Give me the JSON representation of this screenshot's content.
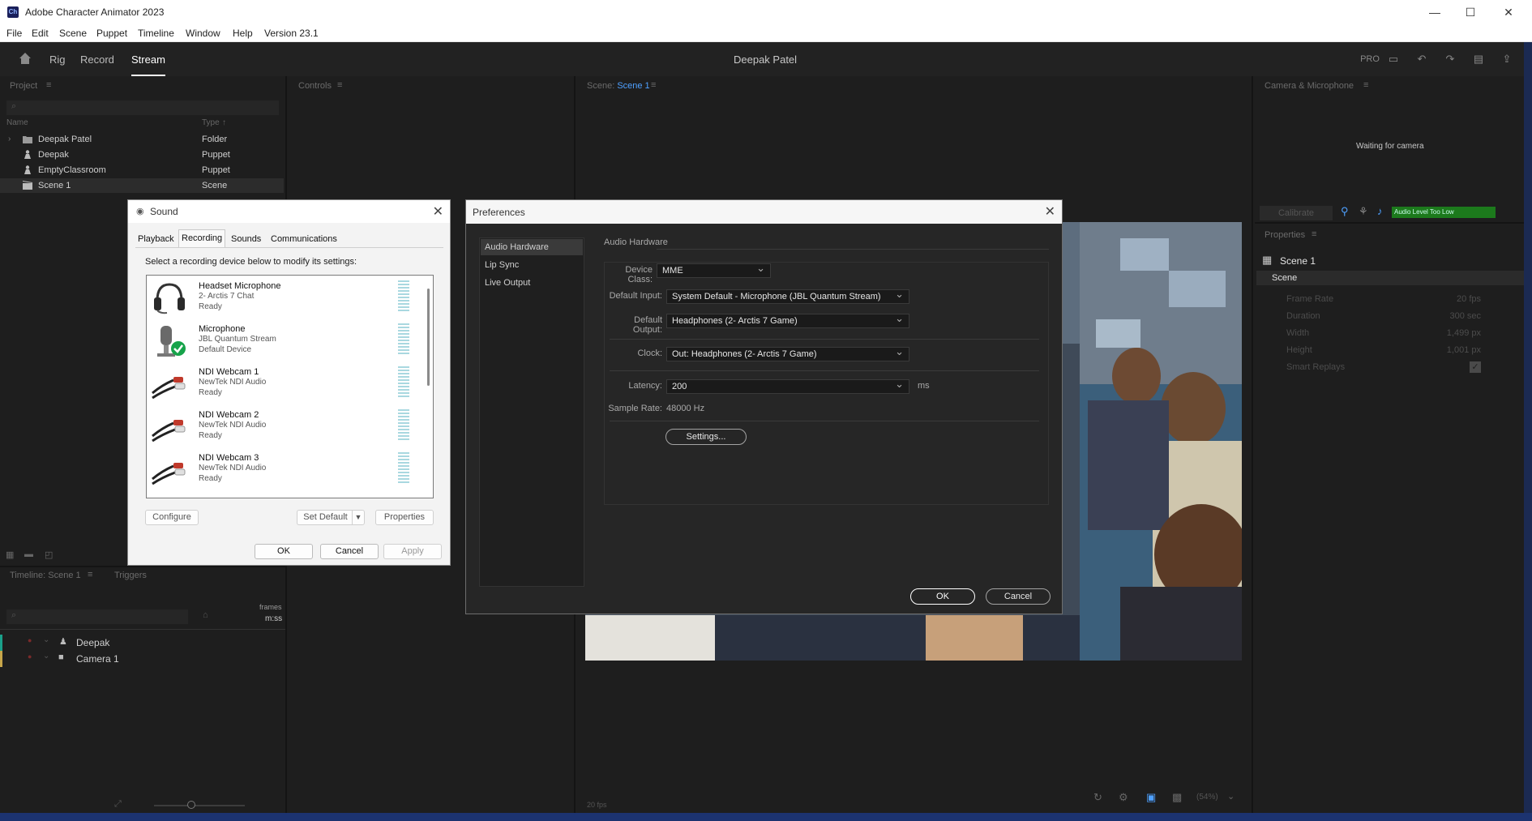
{
  "window": {
    "app_title": "Adobe Character Animator 2023",
    "logo_text": "Ch",
    "minimize": "—",
    "maximize": "☐",
    "close": "✕"
  },
  "menu": [
    "File",
    "Edit",
    "Scene",
    "Puppet",
    "Timeline",
    "Window",
    "Help",
    "Version 23.1"
  ],
  "appbar": {
    "workspaces": [
      "Rig",
      "Record",
      "Stream"
    ],
    "active_workspace": "Stream",
    "center_title": "Deepak Patel",
    "pro_label": "PRO"
  },
  "project": {
    "header": "Project",
    "col_name": "Name",
    "col_type": "Type",
    "items": [
      {
        "name": "Deepak Patel",
        "type": "Folder",
        "icon": "folder-icon"
      },
      {
        "name": "Deepak",
        "type": "Puppet",
        "icon": "puppet-icon"
      },
      {
        "name": "EmptyClassroom",
        "type": "Puppet",
        "icon": "puppet-icon"
      },
      {
        "name": "Scene 1",
        "type": "Scene",
        "icon": "scene-icon"
      }
    ]
  },
  "controls": {
    "header": "Controls"
  },
  "scene": {
    "header_prefix": "Scene:",
    "header_name": "Scene 1",
    "fps": "20 fps",
    "zoom": "(54%)"
  },
  "timeline": {
    "header": "Timeline: Scene 1",
    "triggers_tab": "Triggers",
    "units_top": "frames",
    "units_bottom": "m:ss",
    "tracks": [
      {
        "name": "Deepak",
        "color": "#1aa08a"
      },
      {
        "name": "Camera 1",
        "color": "#c7a64a"
      }
    ]
  },
  "camera_mic": {
    "header": "Camera & Microphone",
    "waiting_text": "Waiting for camera",
    "calibrate_label": "Calibrate",
    "audio_level_text": "Audio Level Too Low",
    "audio_color": "#1c7a1c"
  },
  "properties": {
    "header": "Properties",
    "scene_title": "Scene 1",
    "section": "Scene",
    "rows": [
      {
        "label": "Frame Rate",
        "value": "20 fps"
      },
      {
        "label": "Duration",
        "value": "300 sec"
      },
      {
        "label": "Width",
        "value": "1,499 px"
      },
      {
        "label": "Height",
        "value": "1,001 px"
      },
      {
        "label": "Smart Replays",
        "value": ""
      }
    ]
  },
  "sound_dialog": {
    "title": "Sound",
    "tabs": [
      "Playback",
      "Recording",
      "Sounds",
      "Communications"
    ],
    "active_tab": "Recording",
    "instruction": "Select a recording device below to modify its settings:",
    "devices": [
      {
        "name": "Headset Microphone",
        "line1": "2- Arctis 7 Chat",
        "line2": "Ready",
        "icon": "headset-icon"
      },
      {
        "name": "Microphone",
        "line1": "JBL Quantum Stream",
        "line2": "Default Device",
        "icon": "microphone-icon"
      },
      {
        "name": "NDI Webcam 1",
        "line1": "NewTek NDI Audio",
        "line2": "Ready",
        "icon": "rca-cable-icon"
      },
      {
        "name": "NDI Webcam 2",
        "line1": "NewTek NDI Audio",
        "line2": "Ready",
        "icon": "rca-cable-icon"
      },
      {
        "name": "NDI Webcam 3",
        "line1": "NewTek NDI Audio",
        "line2": "Ready",
        "icon": "rca-cable-icon"
      }
    ],
    "configure": "Configure",
    "set_default": "Set Default",
    "properties": "Properties",
    "ok": "OK",
    "cancel": "Cancel",
    "apply": "Apply"
  },
  "preferences": {
    "title": "Preferences",
    "sidebar": [
      "Audio Hardware",
      "Lip Sync",
      "Live Output"
    ],
    "active": "Audio Hardware",
    "section_title": "Audio Hardware",
    "device_class_label": "Device Class:",
    "device_class": "MME",
    "default_input_label": "Default Input:",
    "default_input": "System Default - Microphone (JBL Quantum Stream)",
    "default_output_label": "Default Output:",
    "default_output": "Headphones (2- Arctis 7 Game)",
    "clock_label": "Clock:",
    "clock": "Out: Headphones (2- Arctis 7 Game)",
    "latency_label": "Latency:",
    "latency": "200",
    "latency_unit": "ms",
    "sample_rate_label": "Sample Rate:",
    "sample_rate": "48000 Hz",
    "settings_button": "Settings...",
    "ok": "OK",
    "cancel": "Cancel"
  }
}
